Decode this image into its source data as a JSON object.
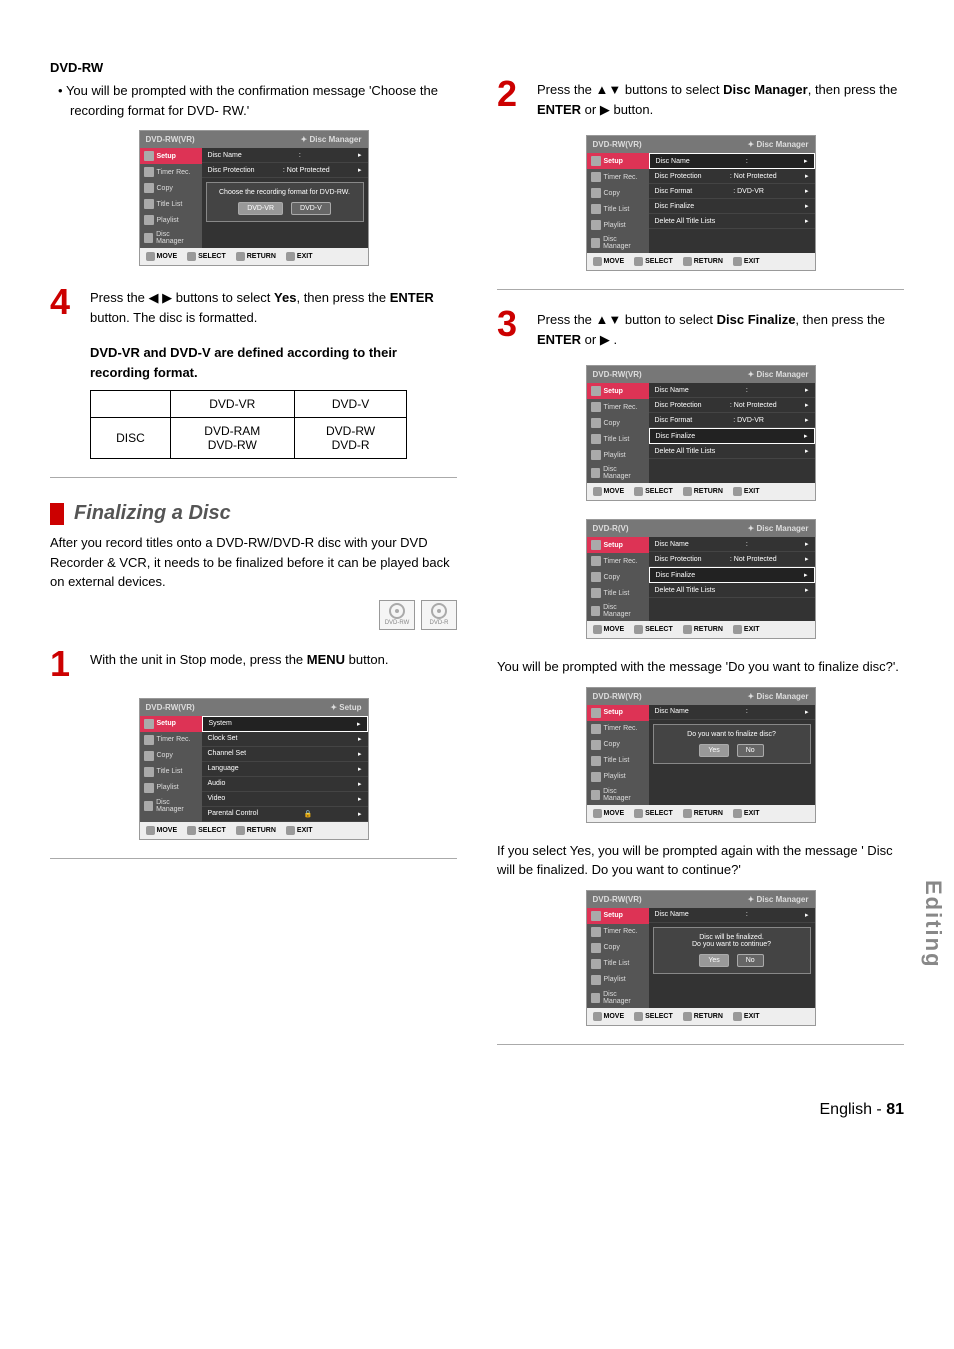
{
  "left": {
    "dvdrw": {
      "title": "DVD-RW",
      "bullet": "You will be prompted with the confirmation message 'Choose the recording format for DVD- RW.'"
    },
    "osd1": {
      "header_left": "DVD-RW(VR)",
      "header_right": "Disc Manager",
      "sidebar": [
        "Setup",
        "Timer Rec.",
        "Copy",
        "Title List",
        "Playlist",
        "Disc Manager"
      ],
      "rows": [
        {
          "l": "Disc Name",
          "r": ":"
        },
        {
          "l": "Disc Protection",
          "r": ": Not Protected"
        }
      ],
      "popup_msg": "Choose the recording format for DVD-RW.",
      "popup_btns": [
        "DVD-VR",
        "DVD-V"
      ],
      "footer": [
        "MOVE",
        "SELECT",
        "RETURN",
        "EXIT"
      ]
    },
    "step4": {
      "num": "4",
      "text_a": "Press the ",
      "text_b": " buttons to select ",
      "text_c": ", then press the ",
      "text_d": " button. The disc is formatted.",
      "yes": "Yes",
      "enter": "ENTER"
    },
    "note": "DVD-VR and DVD-V are defined according to their recording format.",
    "table": {
      "h1": "DVD-VR",
      "h2": "DVD-V",
      "r1": "DISC",
      "c1a": "DVD-RAM",
      "c1b": "DVD-RW",
      "c2a": "DVD-RW",
      "c2b": "DVD-R"
    },
    "finalizing": {
      "title": "Finalizing a Disc",
      "para": "After you record titles onto a DVD-RW/DVD-R disc with your DVD Recorder & VCR, it needs to be finalized before it can be played back on external devices.",
      "disc_labels": [
        "DVD-RW",
        "DVD-R"
      ]
    },
    "step1": {
      "num": "1",
      "text_a": "With the unit in Stop mode, press the ",
      "text_b": " button.",
      "menu": "MENU"
    },
    "osd_setup": {
      "header_left": "DVD-RW(VR)",
      "header_right": "Setup",
      "sidebar": [
        "Setup",
        "Timer Rec.",
        "Copy",
        "Title List",
        "Playlist",
        "Disc Manager"
      ],
      "rows": [
        "System",
        "Clock Set",
        "Channel Set",
        "Language",
        "Audio",
        "Video",
        "Parental Control"
      ],
      "footer": [
        "MOVE",
        "SELECT",
        "RETURN",
        "EXIT"
      ]
    }
  },
  "right": {
    "step2": {
      "num": "2",
      "text_a": "Press the ",
      "text_b": " buttons to select ",
      "text_c": ", then press the ",
      "text_d": " or ",
      "text_e": " button.",
      "dm": "Disc Manager",
      "enter": "ENTER"
    },
    "osd2": {
      "header_left": "DVD-RW(VR)",
      "header_right": "Disc Manager",
      "sidebar": [
        "Setup",
        "Timer Rec.",
        "Copy",
        "Title List",
        "Playlist",
        "Disc Manager"
      ],
      "rows": [
        {
          "l": "Disc Name",
          "r": ":"
        },
        {
          "l": "Disc Protection",
          "r": ": Not Protected"
        },
        {
          "l": "Disc Format",
          "r": ": DVD-VR"
        },
        {
          "l": "Disc Finalize",
          "r": ""
        },
        {
          "l": "Delete All Title Lists",
          "r": ""
        }
      ],
      "footer": [
        "MOVE",
        "SELECT",
        "RETURN",
        "EXIT"
      ]
    },
    "step3": {
      "num": "3",
      "text_a": "Press the ",
      "text_b": " button to select ",
      "text_c": ", then press the ",
      "text_d": " or ",
      "text_e": " .",
      "df": "Disc Finalize",
      "enter": "ENTER"
    },
    "osd3a": {
      "header_left": "DVD-RW(VR)",
      "header_right": "Disc Manager",
      "sidebar": [
        "Setup",
        "Timer Rec.",
        "Copy",
        "Title List",
        "Playlist",
        "Disc Manager"
      ],
      "rows": [
        {
          "l": "Disc Name",
          "r": ":"
        },
        {
          "l": "Disc Protection",
          "r": ": Not Protected"
        },
        {
          "l": "Disc Format",
          "r": ": DVD-VR"
        },
        {
          "l": "Disc Finalize",
          "r": "",
          "sel": true
        },
        {
          "l": "Delete All Title Lists",
          "r": ""
        }
      ],
      "footer": [
        "MOVE",
        "SELECT",
        "RETURN",
        "EXIT"
      ]
    },
    "osd3b": {
      "header_left": "DVD-R(V)",
      "header_right": "Disc Manager",
      "sidebar": [
        "Setup",
        "Timer Rec.",
        "Copy",
        "Title List",
        "Disc Manager"
      ],
      "rows": [
        {
          "l": "Disc Name",
          "r": ":"
        },
        {
          "l": "Disc Protection",
          "r": ": Not Protected"
        },
        {
          "l": "Disc Finalize",
          "r": "",
          "sel": true
        },
        {
          "l": "Delete All Title Lists",
          "r": ""
        }
      ],
      "footer": [
        "MOVE",
        "SELECT",
        "RETURN",
        "EXIT"
      ]
    },
    "para1": "You will be prompted with the message 'Do you want to finalize disc?'.",
    "osd4": {
      "header_left": "DVD-RW(VR)",
      "header_right": "Disc Manager",
      "sidebar": [
        "Setup",
        "Timer Rec.",
        "Copy",
        "Title List",
        "Playlist",
        "Disc Manager"
      ],
      "top_row": {
        "l": "Disc Name",
        "r": ":"
      },
      "popup_msg": "Do you want to finalize disc?",
      "popup_btns": [
        "Yes",
        "No"
      ],
      "footer": [
        "MOVE",
        "SELECT",
        "RETURN",
        "EXIT"
      ]
    },
    "para2": "If you select Yes, you will be prompted again with the  message ' Disc will be finalized. Do you want to continue?'",
    "osd5": {
      "header_left": "DVD-RW(VR)",
      "header_right": "Disc Manager",
      "sidebar": [
        "Setup",
        "Timer Rec.",
        "Copy",
        "Title List",
        "Playlist",
        "Disc Manager"
      ],
      "top_row": {
        "l": "Disc Name",
        "r": ":"
      },
      "popup_line1": "Disc will be finalized.",
      "popup_line2": "Do you want to continue?",
      "popup_btns": [
        "Yes",
        "No"
      ],
      "footer": [
        "MOVE",
        "SELECT",
        "RETURN",
        "EXIT"
      ]
    }
  },
  "side_tab": "Editing",
  "footer": {
    "lang": "English",
    "dash": " - ",
    "page": "81"
  }
}
